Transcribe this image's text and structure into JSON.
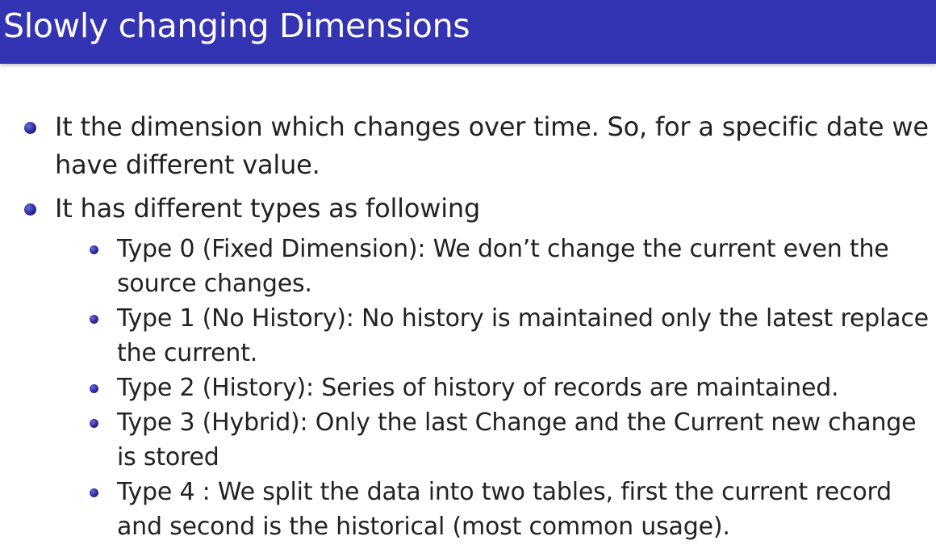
{
  "slide": {
    "title": "Slowly changing Dimensions",
    "bullets": [
      {
        "text": "It the dimension which changes over time. So, for a specific date we have different value."
      },
      {
        "text": "It has different types as following",
        "sub": [
          "Type 0 (Fixed Dimension): We don’t change the current even the source changes.",
          "Type 1 (No History): No history is maintained only the latest replace the current.",
          "Type 2 (History): Series of history of records are maintained.",
          "Type 3 (Hybrid): Only the last Change and the Current new change is stored",
          "Type 4 : We split the data into two tables, first the current record and second is the historical (most common usage)."
        ]
      }
    ],
    "colors": {
      "title_bar": "#3333b3",
      "title_text": "#ffffff",
      "bullet": "#2a2aa0",
      "body_text": "#222222"
    }
  }
}
